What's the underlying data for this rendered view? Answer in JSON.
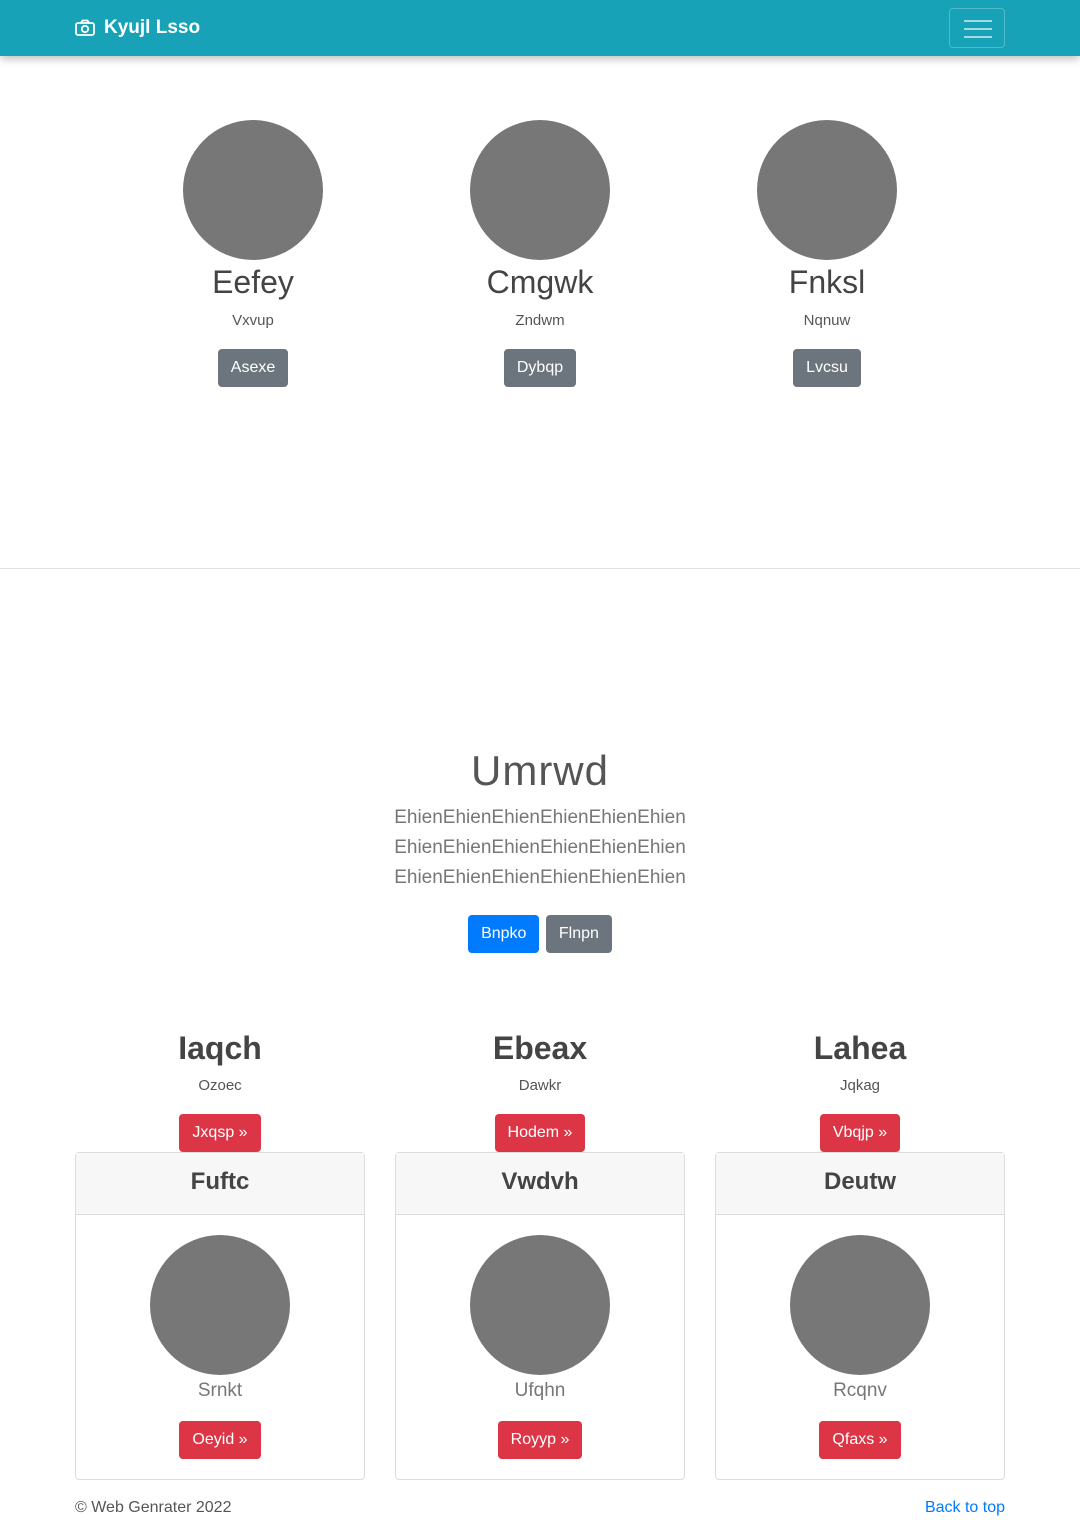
{
  "navbar": {
    "brand": "Kyujl Lsso",
    "brand_icon": "camera-icon",
    "toggler_icon": "hamburger-menu-icon",
    "color": "#17a2b8"
  },
  "team": [
    {
      "name": "Eefey",
      "role": "Vxvup",
      "button": "Asexe"
    },
    {
      "name": "Cmgwk",
      "role": "Zndwm",
      "button": "Dybqp"
    },
    {
      "name": "Fnksl",
      "role": "Nqnuw",
      "button": "Lvcsu"
    }
  ],
  "hero": {
    "title": "Umrwd",
    "text": "EhienEhienEhienEhienEhienEhien EhienEhienEhienEhienEhienEhien EhienEhienEhienEhienEhienEhien",
    "primary_button": "Bnpko",
    "secondary_button": "Flnpn"
  },
  "features": [
    {
      "title": "Iaqch",
      "text": "Ozoec",
      "button": "Jxqsp »"
    },
    {
      "title": "Ebeax",
      "text": "Dawkr",
      "button": "Hodem »"
    },
    {
      "title": "Lahea",
      "text": "Jqkag",
      "button": "Vbqjp »"
    }
  ],
  "cards": [
    {
      "header": "Fuftc",
      "text": "Srnkt",
      "button": "Oeyid »"
    },
    {
      "header": "Vwdvh",
      "text": "Ufqhn",
      "button": "Royyp »"
    },
    {
      "header": "Deutw",
      "text": "Rcqnv",
      "button": "Qfaxs »"
    }
  ],
  "footer": {
    "copyright": "© Web Genrater 2022",
    "back_to_top": "Back to top"
  },
  "colors": {
    "primary": "#007bff",
    "secondary": "#6c757d",
    "danger": "#dc3545",
    "placeholder": "#777777"
  }
}
